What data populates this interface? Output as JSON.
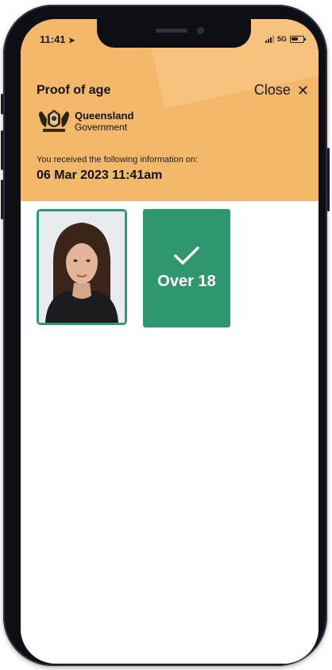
{
  "status_bar": {
    "time": "11:41",
    "network": "5G"
  },
  "header": {
    "title": "Proof of age",
    "close_label": "Close",
    "issuer_line1": "Queensland",
    "issuer_line2": "Government",
    "received_text": "You received the following information on:",
    "received_date": "06 Mar 2023 11:41am"
  },
  "cards": {
    "age_badge_label": "Over 18"
  },
  "colors": {
    "header_bg": "#f3b86a",
    "accent_green": "#2e9770",
    "phone_frame": "#0d0f14"
  }
}
